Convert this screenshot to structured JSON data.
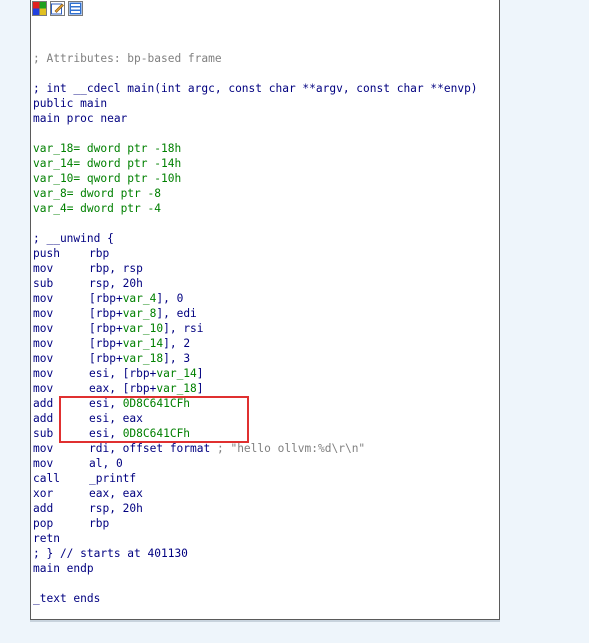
{
  "toolbar": {
    "icons": [
      "color-palette-icon",
      "edit-icon",
      "graph-view-icon"
    ]
  },
  "colors": {
    "comment": "#808080",
    "name": "#000080",
    "value": "#008000",
    "highlight_border": "#e03030"
  },
  "code": {
    "attr_comment": "; Attributes: bp-based frame",
    "proto": "; int __cdecl main(int argc, const char **argv, const char **envp)",
    "public": "public main",
    "proc": "main proc near",
    "vars": [
      {
        "name": "var_18",
        "decl": "= dword ptr -18h"
      },
      {
        "name": "var_14",
        "decl": "= dword ptr -14h"
      },
      {
        "name": "var_10",
        "decl": "= qword ptr -10h"
      },
      {
        "name": "var_8",
        "decl": "= dword ptr -8"
      },
      {
        "name": "var_4",
        "decl": "= dword ptr -4"
      }
    ],
    "unwind": "; __unwind {",
    "instructions": [
      {
        "mn": "push",
        "pre": "rbp",
        "var": "",
        "post": ""
      },
      {
        "mn": "mov",
        "pre": "rbp, rsp",
        "var": "",
        "post": ""
      },
      {
        "mn": "sub",
        "pre": "rsp, 20h",
        "var": "",
        "post": ""
      },
      {
        "mn": "mov",
        "pre": "[rbp+",
        "var": "var_4",
        "post": "], 0"
      },
      {
        "mn": "mov",
        "pre": "[rbp+",
        "var": "var_8",
        "post": "], edi"
      },
      {
        "mn": "mov",
        "pre": "[rbp+",
        "var": "var_10",
        "post": "], rsi"
      },
      {
        "mn": "mov",
        "pre": "[rbp+",
        "var": "var_14",
        "post": "], 2"
      },
      {
        "mn": "mov",
        "pre": "[rbp+",
        "var": "var_18",
        "post": "], 3"
      },
      {
        "mn": "mov",
        "pre": "esi, [rbp+",
        "var": "var_14",
        "post": "]"
      },
      {
        "mn": "mov",
        "pre": "eax, [rbp+",
        "var": "var_18",
        "post": "]"
      },
      {
        "mn": "add",
        "pre": "esi, ",
        "var": "0D8C641CFh",
        "post": ""
      },
      {
        "mn": "add",
        "pre": "esi, eax",
        "var": "",
        "post": ""
      },
      {
        "mn": "sub",
        "pre": "esi, ",
        "var": "0D8C641CFh",
        "post": ""
      },
      {
        "mn": "mov",
        "pre": "rdi, offset format ",
        "var": "",
        "post": "; \"hello ollvm:%d\\r\\n\""
      },
      {
        "mn": "mov",
        "pre": "al, 0",
        "var": "",
        "post": ""
      },
      {
        "mn": "call",
        "pre": "_printf",
        "var": "",
        "post": ""
      },
      {
        "mn": "xor",
        "pre": "eax, eax",
        "var": "",
        "post": ""
      },
      {
        "mn": "add",
        "pre": "rsp, 20h",
        "var": "",
        "post": ""
      },
      {
        "mn": "pop",
        "pre": "rbp",
        "var": "",
        "post": ""
      },
      {
        "mn": "retn",
        "pre": "",
        "var": "",
        "post": ""
      }
    ],
    "unwind_end": "; } // starts at 401130",
    "endp": "main endp",
    "text_ends": "_text ends"
  }
}
